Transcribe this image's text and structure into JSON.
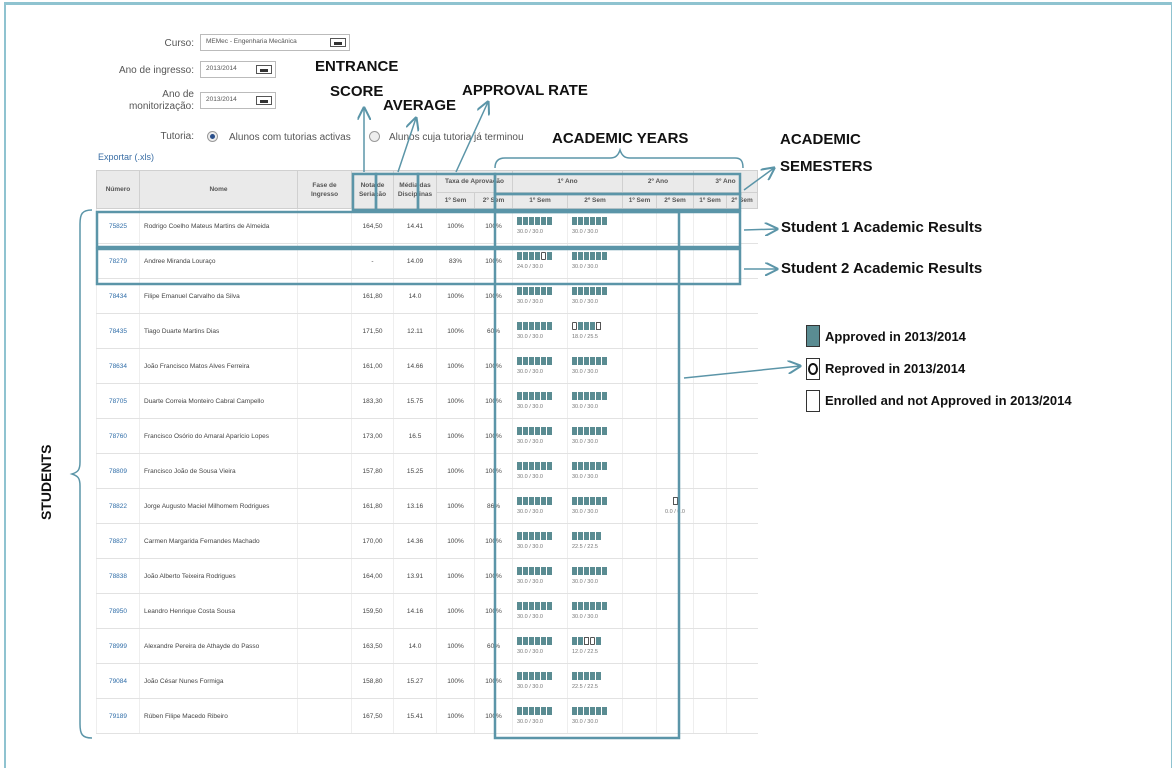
{
  "filters": {
    "course_label": "Curso:",
    "course_value": "MEMec - Engenharia Mecânica",
    "entry_year_label": "Ano de ingresso:",
    "entry_year_value": "2013/2014",
    "monitor_year_label_1": "Ano de",
    "monitor_year_label_2": "monitorização:",
    "monitor_year_value": "2013/2014",
    "tutoring_label": "Tutoria:",
    "tutoring_option_active": "Alunos com tutorias activas",
    "tutoring_option_finished": "Alunos cuja tutoria já terminou",
    "export_link": "Exportar (.xls)"
  },
  "table": {
    "headers": {
      "number": "Número",
      "name": "Nome",
      "phase": "Fase de Ingresso",
      "score": "Nota de Seriação",
      "average": "Média das Disciplinas",
      "approval": "Taxa de Aprovação",
      "year1": "1º Ano",
      "year2": "2º Ano",
      "year3": "3º Ano",
      "sem1": "1º Sem",
      "sem2": "2º Sem"
    },
    "rows": [
      {
        "number": "75825",
        "name": "Rodrigo Coelho Mateus Martins de Almeida",
        "score": "164,50",
        "average": "14.41",
        "rate1": "100%",
        "rate2": "100%",
        "y1s1": "30.0 / 30.0",
        "y1s2": "30.0 / 30.0",
        "y2s2": "",
        "b1": "AAAAAA",
        "b2": "AAAAAA"
      },
      {
        "number": "78279",
        "name": "Andree Miranda Louraço",
        "score": "-",
        "average": "14.09",
        "rate1": "83%",
        "rate2": "100%",
        "y1s1": "24.0 / 30.0",
        "y1s2": "30.0 / 30.0",
        "y2s2": "",
        "b1": "AAAARA",
        "b2": "AAAAAA"
      },
      {
        "number": "78434",
        "name": "Filipe Emanuel Carvalho da Silva",
        "score": "161,80",
        "average": "14.0",
        "rate1": "100%",
        "rate2": "100%",
        "y1s1": "30.0 / 30.0",
        "y1s2": "30.0 / 30.0",
        "y2s2": "",
        "b1": "AAAAAA",
        "b2": "AAAAAA"
      },
      {
        "number": "78435",
        "name": "Tiago Duarte Martins Dias",
        "score": "171,50",
        "average": "12.11",
        "rate1": "100%",
        "rate2": "60%",
        "y1s1": "30.0 / 30.0",
        "y1s2": "18.0 / 25.5",
        "y2s2": "",
        "b1": "AAAAAA",
        "b2": "RAAAE"
      },
      {
        "number": "78634",
        "name": "João Francisco Matos Alves Ferreira",
        "score": "161,00",
        "average": "14.66",
        "rate1": "100%",
        "rate2": "100%",
        "y1s1": "30.0 / 30.0",
        "y1s2": "30.0 / 30.0",
        "y2s2": "",
        "b1": "AAAAAA",
        "b2": "AAAAAA"
      },
      {
        "number": "78705",
        "name": "Duarte Correia Monteiro Cabral Campello",
        "score": "183,30",
        "average": "15.75",
        "rate1": "100%",
        "rate2": "100%",
        "y1s1": "30.0 / 30.0",
        "y1s2": "30.0 / 30.0",
        "y2s2": "",
        "b1": "AAAAAA",
        "b2": "AAAAAA"
      },
      {
        "number": "78760",
        "name": "Francisco Osório do Amaral Aparício Lopes",
        "score": "173,00",
        "average": "16.5",
        "rate1": "100%",
        "rate2": "100%",
        "y1s1": "30.0 / 30.0",
        "y1s2": "30.0 / 30.0",
        "y2s2": "",
        "b1": "AAAAAA",
        "b2": "AAAAAA"
      },
      {
        "number": "78809",
        "name": "Francisco João de Sousa Vieira",
        "score": "157,80",
        "average": "15.25",
        "rate1": "100%",
        "rate2": "100%",
        "y1s1": "30.0 / 30.0",
        "y1s2": "30.0 / 30.0",
        "y2s2": "",
        "b1": "AAAAAA",
        "b2": "AAAAAA"
      },
      {
        "number": "78822",
        "name": "Jorge Augusto Maciel Milhomem Rodrigues",
        "score": "161,80",
        "average": "13.16",
        "rate1": "100%",
        "rate2": "86%",
        "y1s1": "30.0 / 30.0",
        "y1s2": "30.0 / 30.0",
        "y2s2": "0.0 / 6.0",
        "b1": "AAAAAA",
        "b2": "AAAAAA"
      },
      {
        "number": "78827",
        "name": "Carmen Margarida Fernandes Machado",
        "score": "170,00",
        "average": "14.36",
        "rate1": "100%",
        "rate2": "100%",
        "y1s1": "30.0 / 30.0",
        "y1s2": "22.5 / 22.5",
        "y2s2": "",
        "b1": "AAAAAA",
        "b2": "AAAAA"
      },
      {
        "number": "78838",
        "name": "João Alberto Teixeira Rodrigues",
        "score": "164,00",
        "average": "13.91",
        "rate1": "100%",
        "rate2": "100%",
        "y1s1": "30.0 / 30.0",
        "y1s2": "30.0 / 30.0",
        "y2s2": "",
        "b1": "AAAAAA",
        "b2": "AAAAAA"
      },
      {
        "number": "78950",
        "name": "Leandro Henrique Costa Sousa",
        "score": "159,50",
        "average": "14.16",
        "rate1": "100%",
        "rate2": "100%",
        "y1s1": "30.0 / 30.0",
        "y1s2": "30.0 / 30.0",
        "y2s2": "",
        "b1": "AAAAAA",
        "b2": "AAAAAA"
      },
      {
        "number": "78999",
        "name": "Alexandre Pereira de Athayde do Passo",
        "score": "163,50",
        "average": "14.0",
        "rate1": "100%",
        "rate2": "60%",
        "y1s1": "30.0 / 30.0",
        "y1s2": "12.0 / 22.5",
        "y2s2": "",
        "b1": "AAAAAA",
        "b2": "AAERA"
      },
      {
        "number": "79084",
        "name": "João César Nunes Formiga",
        "score": "158,80",
        "average": "15.27",
        "rate1": "100%",
        "rate2": "100%",
        "y1s1": "30.0 / 30.0",
        "y1s2": "22.5 / 22.5",
        "y2s2": "",
        "b1": "AAAAAA",
        "b2": "AAAAA"
      },
      {
        "number": "79189",
        "name": "Rúben Filipe Macedo Ribeiro",
        "score": "167,50",
        "average": "15.41",
        "rate1": "100%",
        "rate2": "100%",
        "y1s1": "30.0 / 30.0",
        "y1s2": "30.0 / 30.0",
        "y2s2": "",
        "b1": "AAAAAA",
        "b2": "AAAAAA"
      }
    ]
  },
  "annotations": {
    "entrance_1": "ENTRANCE",
    "entrance_2": "SCORE",
    "average": "AVERAGE",
    "approval": "APPROVAL RATE",
    "academic_years": "ACADEMIC YEARS",
    "semesters_1": "ACADEMIC",
    "semesters_2": "SEMESTERS",
    "student1": "Student 1 Academic Results",
    "student2": "Student 2 Academic Results",
    "students": "STUDENTS",
    "legend_approved": "Approved in 2013/2014",
    "legend_reproved": "Reproved in 2013/2014",
    "legend_enrolled": "Enrolled and not Approved in 2013/2014"
  },
  "colors": {
    "highlight": "#5b95a8",
    "approved_block": "#5a8c92",
    "link": "#2f6da8"
  }
}
